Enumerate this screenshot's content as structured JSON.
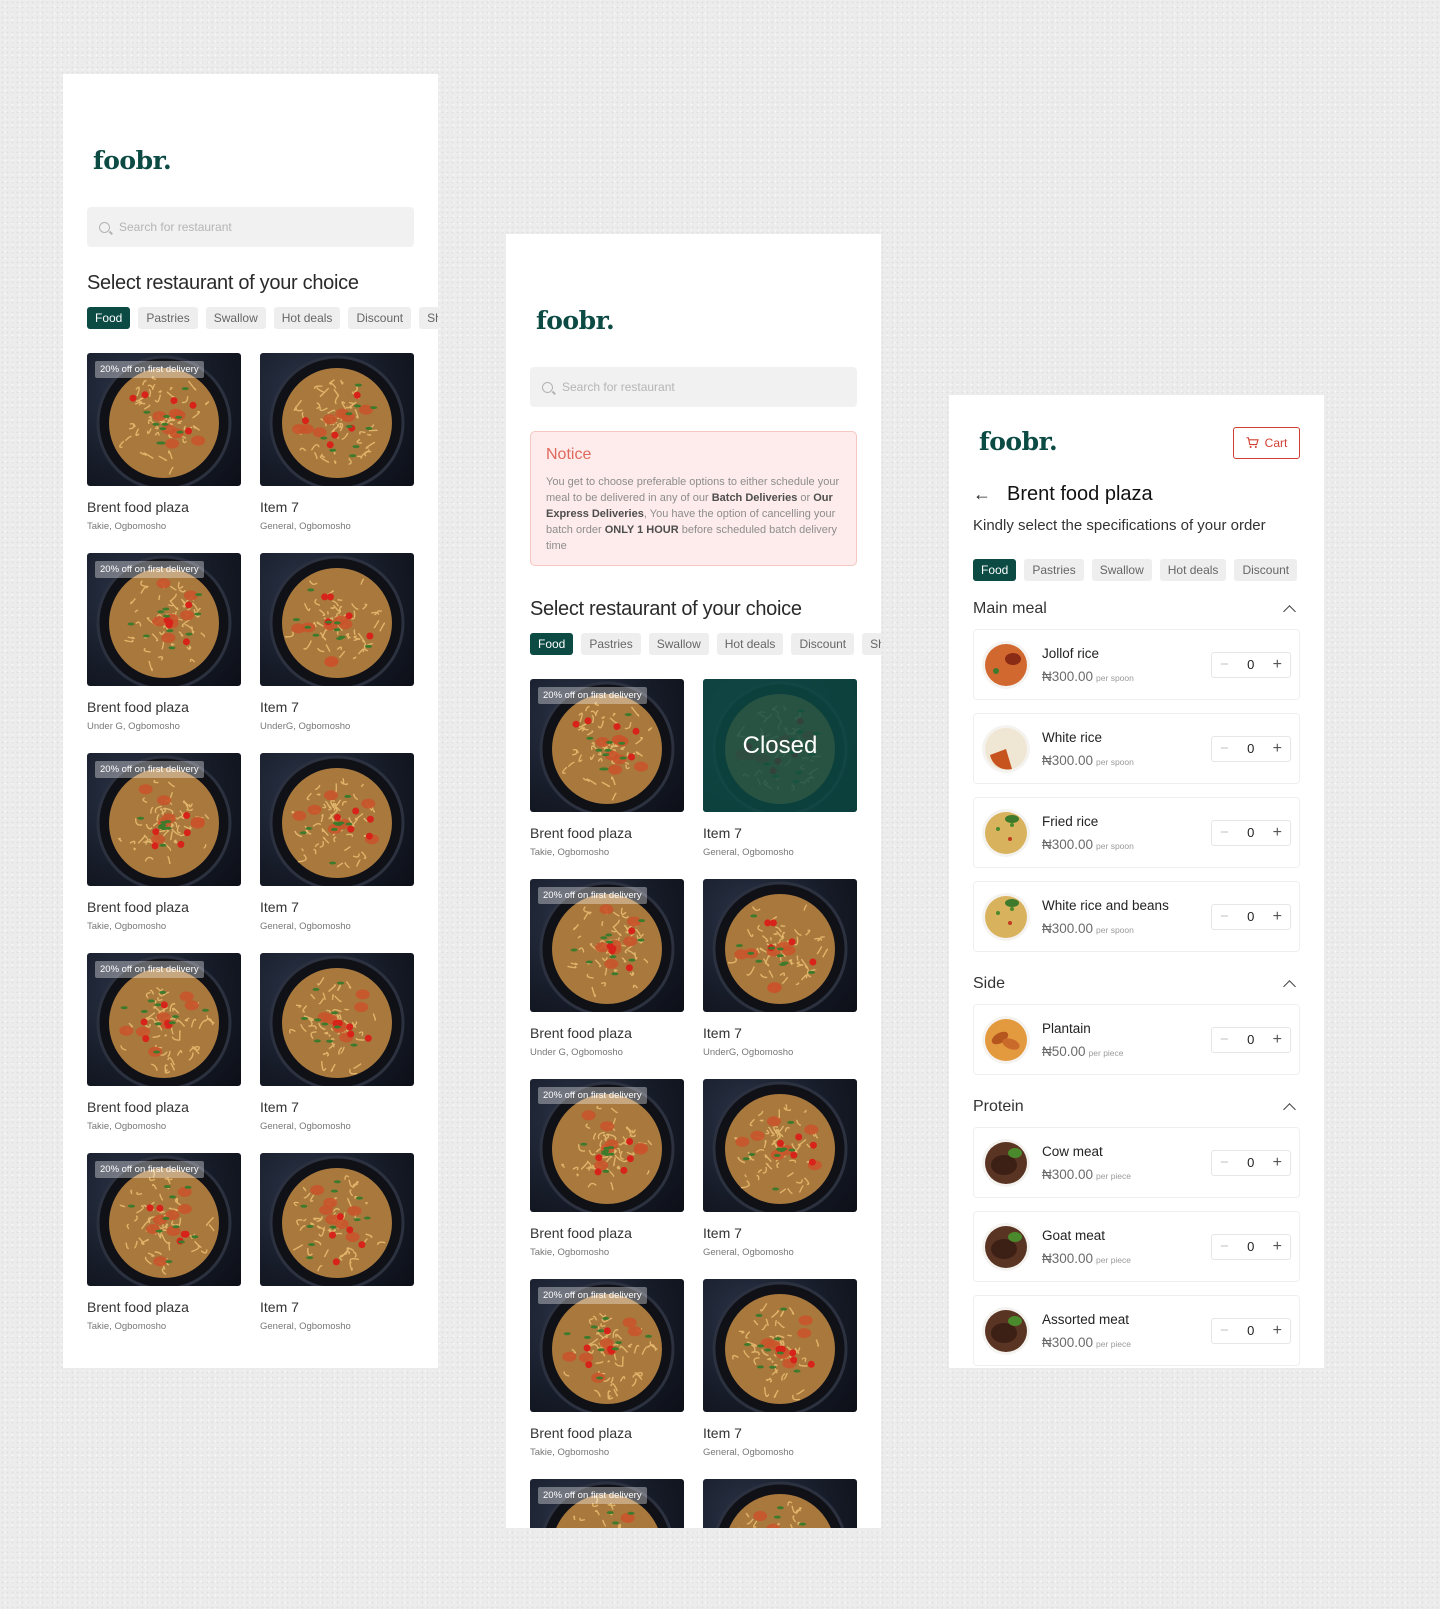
{
  "brand": "foobr.",
  "search_placeholder": "Search for restaurant",
  "section_title": "Select restaurant of your choice",
  "filters": [
    "Food",
    "Pastries",
    "Swallow",
    "Hot deals",
    "Discount",
    "Sha"
  ],
  "colors": {
    "brand": "#0c4a44",
    "accent_red": "#d23f31",
    "notice_bg": "#fdeceb"
  },
  "listing": [
    {
      "name": "Brent food plaza",
      "location": "Takie, Ogbomosho",
      "badge": "20% off on first delivery"
    },
    {
      "name": "Item 7",
      "location": "General, Ogbomosho"
    },
    {
      "name": "Brent food plaza",
      "location": "Under G, Ogbomosho",
      "badge": "20% off on first delivery"
    },
    {
      "name": "Item 7",
      "location": "UnderG, Ogbomosho"
    },
    {
      "name": "Brent food plaza",
      "location": "Takie, Ogbomosho",
      "badge": "20% off on first delivery"
    },
    {
      "name": "Item 7",
      "location": "General, Ogbomosho"
    },
    {
      "name": "Brent food plaza",
      "location": "Takie, Ogbomosho",
      "badge": "20% off on first delivery"
    },
    {
      "name": "Item 7",
      "location": "General, Ogbomosho"
    },
    {
      "name": "Brent food plaza",
      "location": "Takie, Ogbomosho",
      "badge": "20% off on first delivery"
    },
    {
      "name": "Item 7",
      "location": "General, Ogbomosho"
    }
  ],
  "notice": {
    "title": "Notice",
    "p1": "You get to choose preferable options to either schedule your meal to be delivered in any of our ",
    "b1": "Batch Deliveries",
    "p2": " or ",
    "b2": "Our Express Deliveries",
    "p3": ", You have the option of cancelling your batch order ",
    "b3": "ONLY 1 HOUR",
    "p4": " before scheduled batch delivery time"
  },
  "listing2": [
    {
      "name": "Brent food plaza",
      "location": "Takie, Ogbomosho",
      "badge": "20% off on first delivery"
    },
    {
      "name": "Item 7",
      "location": "General, Ogbomosho",
      "closed": "Closed"
    },
    {
      "name": "Brent food plaza",
      "location": "Under G, Ogbomosho",
      "badge": "20% off on first delivery"
    },
    {
      "name": "Item 7",
      "location": "UnderG, Ogbomosho"
    },
    {
      "name": "Brent food plaza",
      "location": "Takie, Ogbomosho",
      "badge": "20% off on first delivery"
    },
    {
      "name": "Item 7",
      "location": "General, Ogbomosho"
    },
    {
      "name": "Brent food plaza",
      "location": "Takie, Ogbomosho",
      "badge": "20% off on first delivery"
    },
    {
      "name": "Item 7",
      "location": "General, Ogbomosho"
    },
    {
      "name": "",
      "location": "",
      "badge": "20% off on first delivery"
    },
    {
      "name": "",
      "location": ""
    }
  ],
  "detail": {
    "cart_label": "Cart",
    "restaurant": "Brent food plaza",
    "subtitle": "Kindly select the specifications of your order",
    "filters": [
      "Food",
      "Pastries",
      "Swallow",
      "Hot deals",
      "Discount"
    ],
    "sections": [
      {
        "title": "Main meal",
        "items": [
          {
            "name": "Jollof rice",
            "price": "₦300.00",
            "unit": "per spoon",
            "qty": "0",
            "kind": "jollof"
          },
          {
            "name": "White rice",
            "price": "₦300.00",
            "unit": "per spoon",
            "qty": "0",
            "kind": "white"
          },
          {
            "name": "Fried rice",
            "price": "₦300.00",
            "unit": "per spoon",
            "qty": "0",
            "kind": "fried"
          },
          {
            "name": "White rice and beans",
            "price": "₦300.00",
            "unit": "per spoon",
            "qty": "0",
            "kind": "fried"
          }
        ]
      },
      {
        "title": "Side",
        "items": [
          {
            "name": "Plantain",
            "price": "₦50.00",
            "unit": "per piece",
            "qty": "0",
            "kind": "plantain"
          }
        ]
      },
      {
        "title": "Protein",
        "items": [
          {
            "name": "Cow meat",
            "price": "₦300.00",
            "unit": "per piece",
            "qty": "0",
            "kind": "meat"
          },
          {
            "name": "Goat meat",
            "price": "₦300.00",
            "unit": "per piece",
            "qty": "0",
            "kind": "meat"
          },
          {
            "name": "Assorted meat",
            "price": "₦300.00",
            "unit": "per piece",
            "qty": "0",
            "kind": "meat"
          }
        ]
      }
    ]
  }
}
